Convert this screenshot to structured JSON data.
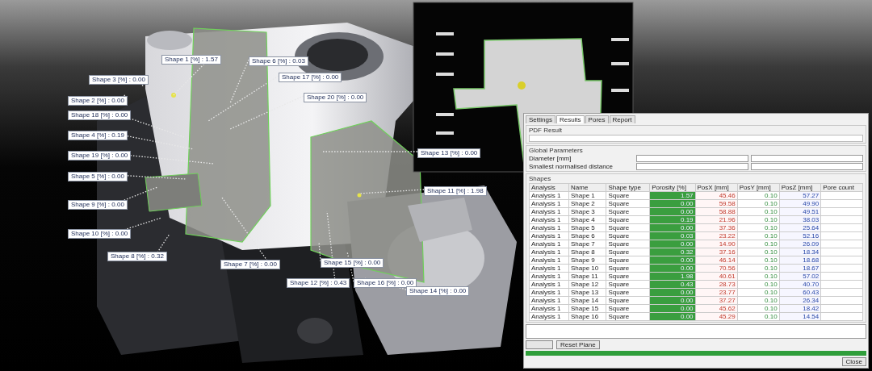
{
  "callouts": [
    {
      "text": "Shape 1 [%] : 1.57"
    },
    {
      "text": "Shape 6 [%] : 0.03"
    },
    {
      "text": "Shape 3 [%] : 0.00"
    },
    {
      "text": "Shape 17 [%] : 0.00"
    },
    {
      "text": "Shape 2 [%] : 0.00"
    },
    {
      "text": "Shape 20 [%] : 0.00"
    },
    {
      "text": "Shape 18 [%] : 0.00"
    },
    {
      "text": "Shape 4 [%] : 0.19"
    },
    {
      "text": "Shape 19 [%] : 0.00"
    },
    {
      "text": "Shape 13 [%] : 0.00"
    },
    {
      "text": "Shape 5 [%] : 0.00"
    },
    {
      "text": "Shape 11 [%] : 1.98"
    },
    {
      "text": "Shape 9 [%] : 0.00"
    },
    {
      "text": "Shape 10 [%] : 0.00"
    },
    {
      "text": "Shape 8 [%] : 0.32"
    },
    {
      "text": "Shape 7 [%] : 0.00"
    },
    {
      "text": "Shape 15 [%] : 0.00"
    },
    {
      "text": "Shape 12 [%] : 0.43"
    },
    {
      "text": "Shape 16 [%] : 0.00"
    },
    {
      "text": "Shape 14 [%] : 0.00"
    }
  ],
  "results_window": {
    "tabs": [
      {
        "label": "Settings",
        "selected": false
      },
      {
        "label": "Results",
        "selected": true
      },
      {
        "label": "Pores",
        "selected": false
      },
      {
        "label": "Report",
        "selected": false
      }
    ],
    "pdf_result": {
      "title": "PDF Result"
    },
    "global_parameters": {
      "title": "Global Parameters",
      "fields": [
        {
          "label": "Diameter [mm]"
        },
        {
          "label": "Smallest normalised distance"
        }
      ]
    },
    "shapes": {
      "title": "Shapes",
      "columns": [
        "Analysis",
        "Name",
        "Shape type",
        "Porosity [%]",
        "PosX [mm]",
        "PosY [mm]",
        "PosZ [mm]",
        "Pore count"
      ],
      "rows": [
        [
          "Analysis 1",
          "Shape 1",
          "Square",
          "1.57",
          "45.46",
          "0.10",
          "57.27"
        ],
        [
          "Analysis 1",
          "Shape 2",
          "Square",
          "0.00",
          "59.58",
          "0.10",
          "49.90"
        ],
        [
          "Analysis 1",
          "Shape 3",
          "Square",
          "0.00",
          "58.88",
          "0.10",
          "49.51"
        ],
        [
          "Analysis 1",
          "Shape 4",
          "Square",
          "0.19",
          "21.96",
          "0.10",
          "38.03"
        ],
        [
          "Analysis 1",
          "Shape 5",
          "Square",
          "0.00",
          "37.36",
          "0.10",
          "25.64"
        ],
        [
          "Analysis 1",
          "Shape 6",
          "Square",
          "0.03",
          "23.22",
          "0.10",
          "52.16"
        ],
        [
          "Analysis 1",
          "Shape 7",
          "Square",
          "0.00",
          "14.90",
          "0.10",
          "26.09"
        ],
        [
          "Analysis 1",
          "Shape 8",
          "Square",
          "0.32",
          "37.16",
          "0.10",
          "18.34"
        ],
        [
          "Analysis 1",
          "Shape 9",
          "Square",
          "0.00",
          "46.14",
          "0.10",
          "18.68"
        ],
        [
          "Analysis 1",
          "Shape 10",
          "Square",
          "0.00",
          "70.56",
          "0.10",
          "18.67"
        ],
        [
          "Analysis 1",
          "Shape 11",
          "Square",
          "1.98",
          "40.61",
          "0.10",
          "57.02"
        ],
        [
          "Analysis 1",
          "Shape 12",
          "Square",
          "0.43",
          "28.73",
          "0.10",
          "40.70"
        ],
        [
          "Analysis 1",
          "Shape 13",
          "Square",
          "0.00",
          "23.77",
          "0.10",
          "60.43"
        ],
        [
          "Analysis 1",
          "Shape 14",
          "Square",
          "0.00",
          "37.27",
          "0.10",
          "26.34"
        ],
        [
          "Analysis 1",
          "Shape 15",
          "Square",
          "0.00",
          "45.62",
          "0.10",
          "18.42"
        ],
        [
          "Analysis 1",
          "Shape 16",
          "Square",
          "0.00",
          "45.29",
          "0.10",
          "14.54"
        ]
      ]
    },
    "buttons": [
      {
        "label": "Reset Plane"
      },
      {
        "label": "Close"
      }
    ]
  }
}
